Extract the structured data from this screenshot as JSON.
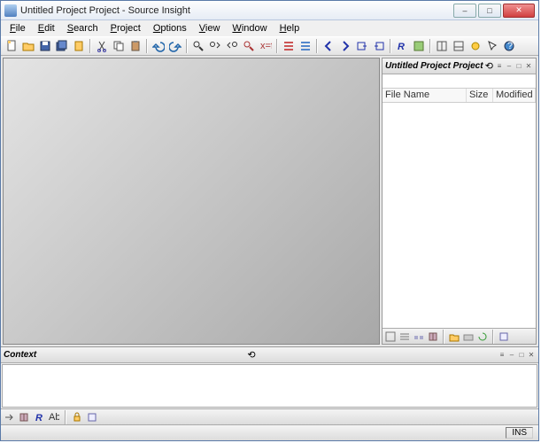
{
  "titlebar": {
    "title": "Untitled Project Project - Source Insight"
  },
  "menu": {
    "file": "File",
    "edit": "Edit",
    "search": "Search",
    "project": "Project",
    "options": "Options",
    "view": "View",
    "window": "Window",
    "help": "Help"
  },
  "toolbar_icons": [
    "new-file",
    "open-file",
    "save",
    "save-all",
    "close",
    "cut",
    "copy",
    "paste",
    "undo",
    "redo",
    "find",
    "find-next",
    "find-prev",
    "bookmark",
    "regex",
    "list-1",
    "list-2",
    "nav-back",
    "nav-forward",
    "goto-def",
    "goto-ref",
    "relation",
    "parse",
    "layout",
    "context",
    "symbol",
    "arrow",
    "help"
  ],
  "project_panel": {
    "title": "Untitled Project Project",
    "columns": {
      "name": "File Name",
      "size": "Size",
      "modified": "Modified"
    },
    "panel_tb": [
      "view-list",
      "view-detail",
      "view-tree",
      "book",
      "sep",
      "open",
      "close",
      "refresh",
      "sep",
      "props"
    ]
  },
  "context_panel": {
    "title": "Context",
    "panel_tb": [
      "nav",
      "book",
      "relation",
      "abc",
      "sep",
      "lock",
      "props"
    ]
  },
  "statusbar": {
    "ins": "INS"
  },
  "window_controls": {
    "min": "–",
    "max": "□",
    "close": "✕"
  },
  "panel_controls": {
    "expand": "≡",
    "min": "–",
    "restore": "□",
    "close": "✕"
  }
}
